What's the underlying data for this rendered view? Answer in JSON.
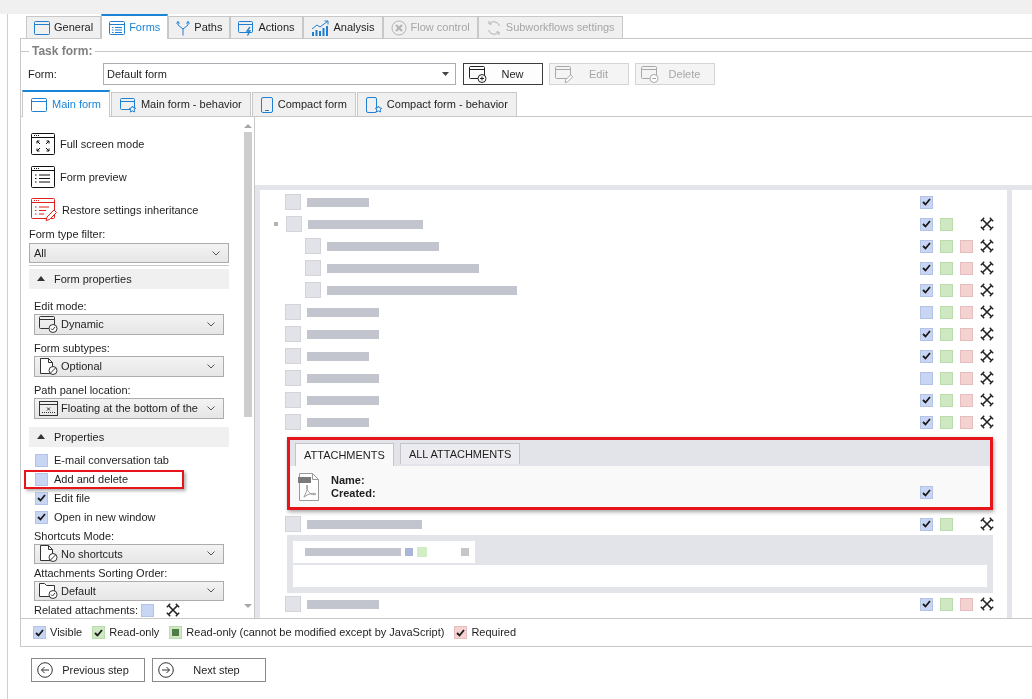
{
  "tabs": [
    {
      "label": "General",
      "selected": false,
      "disabled": false
    },
    {
      "label": "Forms",
      "selected": true,
      "disabled": false
    },
    {
      "label": "Paths",
      "selected": false,
      "disabled": false
    },
    {
      "label": "Actions",
      "selected": false,
      "disabled": false
    },
    {
      "label": "Analysis",
      "selected": false,
      "disabled": false
    },
    {
      "label": "Flow control",
      "selected": false,
      "disabled": true
    },
    {
      "label": "Subworkflows settings",
      "selected": false,
      "disabled": true
    }
  ],
  "task_form": {
    "title": "Task form:",
    "form_label": "Form:",
    "form_value": "Default form",
    "buttons": [
      {
        "label": "New",
        "disabled": false
      },
      {
        "label": "Edit",
        "disabled": true
      },
      {
        "label": "Delete",
        "disabled": true
      }
    ]
  },
  "form_tabs": [
    {
      "label": "Main form",
      "selected": true
    },
    {
      "label": "Main form - behavior",
      "selected": false
    },
    {
      "label": "Compact form",
      "selected": false
    },
    {
      "label": "Compact form - behavior",
      "selected": false
    }
  ],
  "left_panel": {
    "actions": [
      {
        "label": "Full screen mode"
      },
      {
        "label": "Form preview"
      },
      {
        "label": "Restore settings inheritance"
      }
    ],
    "filter": {
      "label": "Form type filter:",
      "value": "All"
    },
    "sections": [
      {
        "title": "Form properties",
        "expanded": true,
        "items": [
          {
            "kind": "dropdown",
            "label": "Edit mode:",
            "value": "Dynamic"
          },
          {
            "kind": "dropdown",
            "label": "Form subtypes:",
            "value": "Optional"
          },
          {
            "kind": "dropdown",
            "label": "Path panel location:",
            "value": "Floating at the bottom of the"
          }
        ]
      },
      {
        "title": "Properties",
        "expanded": true,
        "items": [
          {
            "kind": "checkbox",
            "label": "E-mail conversation tab",
            "checked": false,
            "highlighted": false
          },
          {
            "kind": "checkbox",
            "label": "Add and delete",
            "checked": false,
            "highlighted": true
          },
          {
            "kind": "checkbox",
            "label": "Edit file",
            "checked": true,
            "highlighted": false
          },
          {
            "kind": "checkbox",
            "label": "Open in new window",
            "checked": true,
            "highlighted": false
          },
          {
            "kind": "dropdown",
            "label": "Shortcuts Mode:",
            "value": "No shortcuts"
          },
          {
            "kind": "dropdown",
            "label": "Attachments Sorting Order:",
            "value": "Default"
          },
          {
            "kind": "setting",
            "label": "Related attachments:",
            "visible": false
          }
        ]
      }
    ]
  },
  "form_tree": {
    "rows": [
      {
        "kind": "field",
        "visible": true
      },
      {
        "kind": "group",
        "visible": true,
        "read_only": false,
        "tools": true,
        "children": [
          {
            "kind": "field",
            "visible": true,
            "read_only": false,
            "required": false,
            "tools": true
          },
          {
            "kind": "field",
            "visible": true,
            "read_only": false,
            "required": false,
            "tools": true
          },
          {
            "kind": "field",
            "visible": true,
            "read_only": false,
            "required": false,
            "tools": true
          }
        ]
      },
      {
        "kind": "field",
        "visible": false,
        "read_only": false,
        "required": false,
        "tools": true
      },
      {
        "kind": "field",
        "visible": true,
        "read_only": false,
        "required": false,
        "tools": true
      },
      {
        "kind": "field",
        "visible": true,
        "read_only": false,
        "required": false,
        "tools": true
      },
      {
        "kind": "field",
        "visible": false,
        "read_only": false,
        "required": false,
        "tools": true
      },
      {
        "kind": "field",
        "visible": true,
        "read_only": false,
        "required": false,
        "tools": true
      },
      {
        "kind": "field",
        "visible": true,
        "read_only": false,
        "required": false,
        "tools": true
      },
      {
        "kind": "attachments",
        "highlighted": true,
        "tabs": [
          {
            "label": "ATTACHMENTS",
            "selected": true
          },
          {
            "label": "ALL ATTACHMENTS",
            "selected": false
          }
        ],
        "fields": [
          "Name:",
          "Created:"
        ],
        "visible": true
      },
      {
        "kind": "panel",
        "visible": true,
        "read_only": false,
        "tools": true
      },
      {
        "kind": "field",
        "visible": true,
        "read_only": false,
        "required": false,
        "tools": true
      }
    ]
  },
  "legend": [
    {
      "kind": "visible",
      "label": "Visible",
      "checked": true
    },
    {
      "kind": "read_only",
      "label": "Read-only",
      "checked": true
    },
    {
      "kind": "script_read_only",
      "label": "Read-only (cannot be modified except by JavaScript)",
      "checked": true
    },
    {
      "kind": "required",
      "label": "Required",
      "checked": true
    }
  ],
  "navigation": [
    {
      "kind": "previous",
      "label": "Previous step"
    },
    {
      "kind": "next",
      "label": "Next step"
    }
  ]
}
